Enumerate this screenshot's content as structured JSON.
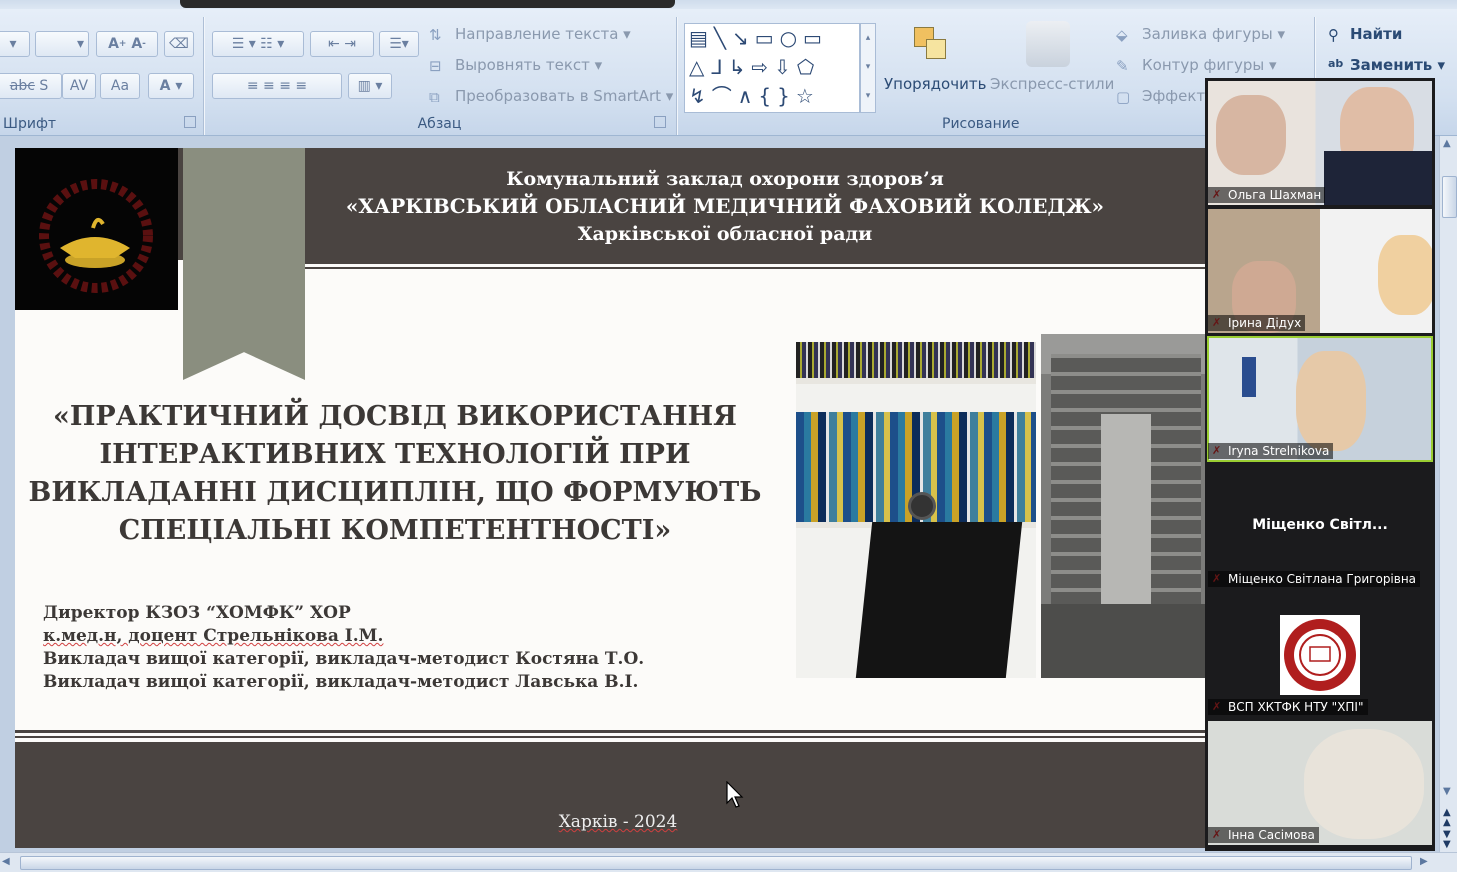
{
  "ribbon": {
    "font_group_label": "Шрифт",
    "paragraph_group_label": "Абзац",
    "drawing_group_label": "Рисование",
    "text_direction": "Направление текста",
    "align_text": "Выровнять текст",
    "convert_smartart": "Преобразовать в SmartArt",
    "arrange": "Упорядочить",
    "quick_styles": "Экспресс-стили",
    "shape_fill": "Заливка фигуры",
    "shape_outline": "Контур фигуры",
    "effects": "Эффекты",
    "find": "Найти",
    "replace": "Заменить"
  },
  "slide": {
    "header_line1": "Комунальний заклад охорони здоров’я",
    "header_line2": "«ХАРКІВСЬКИЙ ОБЛАСНИЙ МЕДИЧНИЙ ФАХОВИЙ КОЛЕДЖ»",
    "header_line3": "Харківської обласної ради",
    "title_lines": [
      "«ПРАКТИЧНИЙ ДОСВІД ВИКОРИСТАННЯ",
      "ІНТЕРАКТИВНИХ ТЕХНОЛОГІЙ ПРИ",
      "ВИКЛАДАННІ ДИСЦИПЛІН, ЩО ФОРМУЮТЬ",
      "СПЕЦІАЛЬНІ КОМПЕТЕНТНОСТІ»"
    ],
    "authors": [
      "Директор КЗОЗ “ХОМФК” ХОР",
      "к.мед.н, доцент Стрельнікова І.М.",
      "Викладач вищої  категорії, викладач-методист Костяна Т.О.",
      "Викладач вищої категорії, викладач-методист Лавська В.І."
    ],
    "city_year": "Харків - 2024"
  },
  "participants": [
    {
      "name": "Ольга Шахман"
    },
    {
      "name": "Ірина Дідух"
    },
    {
      "name": "Iryna Strelnikova"
    },
    {
      "name": "Міщенко Світлана Григорівна",
      "short": "Міщенко  Світл..."
    },
    {
      "name": "ВСП ХКТФК НТУ \"ХПІ\""
    },
    {
      "name": "Інна Сасімова"
    }
  ],
  "colors": {
    "slide_dark": "#4a4441",
    "ribbon_bg": "#dbe6f3",
    "active_speaker": "#9acd32",
    "muted_mic": "#e03030"
  }
}
